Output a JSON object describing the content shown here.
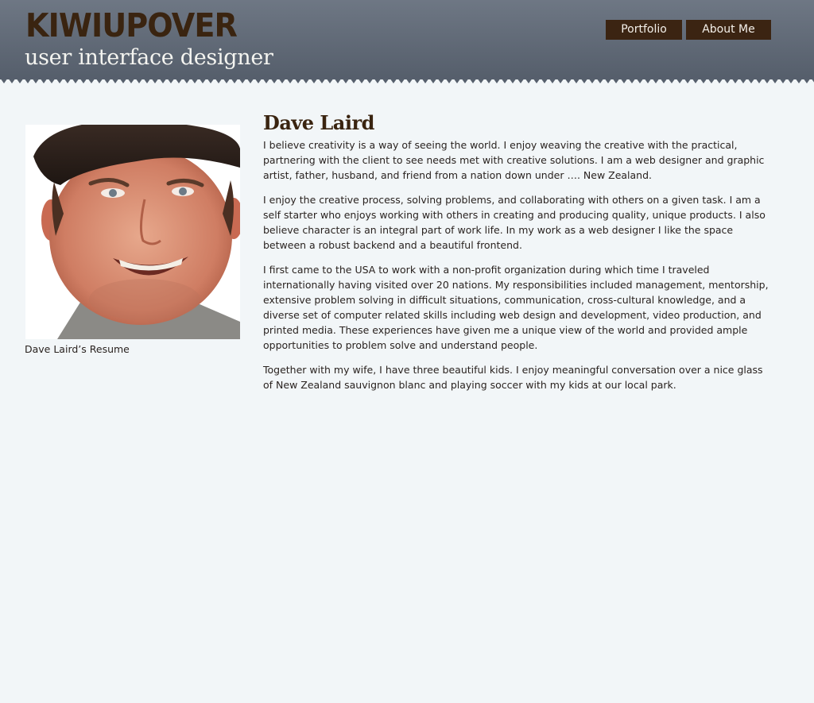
{
  "header": {
    "logo": "KIWIUPOVER",
    "tagline": "user interface designer",
    "nav": [
      {
        "label": "Portfolio"
      },
      {
        "label": "About Me"
      }
    ]
  },
  "sidebar": {
    "photo_alt": "Dave Laird",
    "caption": "Dave Laird’s Resume"
  },
  "main": {
    "name": "Dave Laird",
    "paragraphs": [
      "I believe creativity is a way of seeing the world. I enjoy weaving the creative with the practical, partnering with the client to see needs met with creative solutions. I am a web designer and graphic artist, father, husband, and friend from a nation down under …. New Zealand.",
      "I enjoy the creative process, solving problems, and collaborating with others on a given task. I am a self starter who enjoys working with others in creating and producing quality, unique products. I also believe character is an integral part of work life. In my work as a web designer I like the space between a robust backend and a beautiful frontend.",
      "I first came to the USA to work with a non-profit organization during which time I traveled internationally having visited over 20 nations. My responsibilities included management, mentorship, extensive problem solving in difficult situations, communication, cross-cultural knowledge, and a diverse set of computer related skills including web design and development, video production, and printed media. These experiences have given me a unique view of the world and provided ample opportunities to problem solve and understand people.",
      "Together with my wife, I have three beautiful kids. I enjoy meaningful conversation over a nice glass of New Zealand sauvignon blanc and playing soccer with my kids at our local park."
    ]
  },
  "colors": {
    "header_bg": "#5f6875",
    "brand_brown": "#3b2412",
    "page_bg": "#f2f6f8"
  }
}
